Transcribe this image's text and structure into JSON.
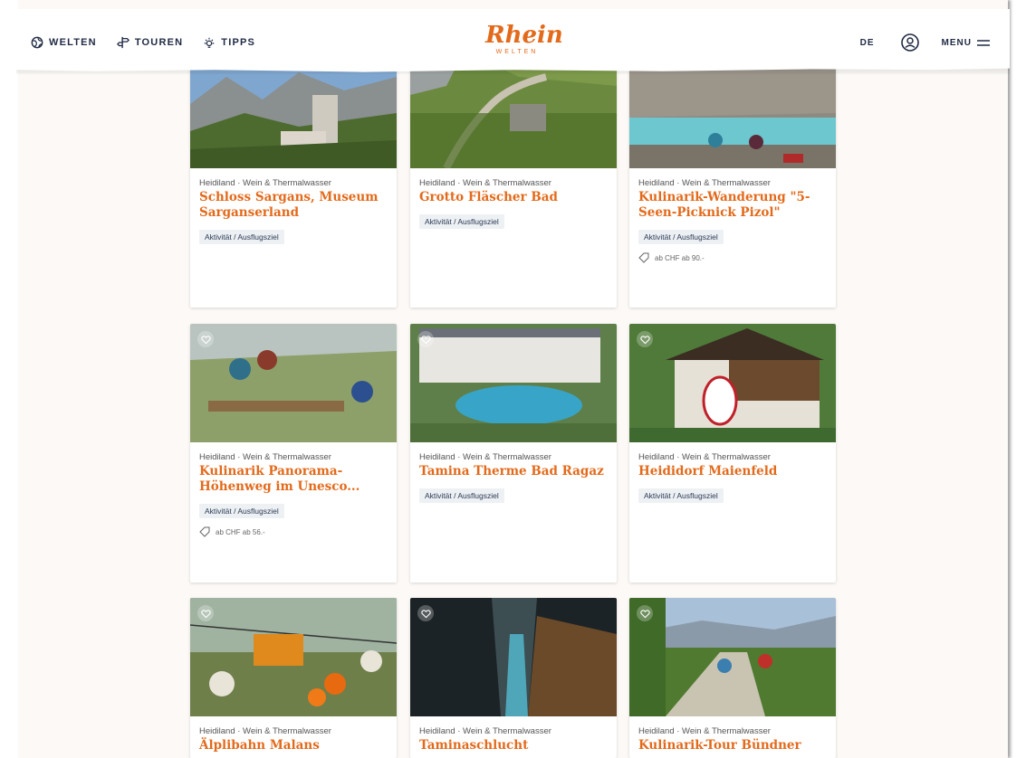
{
  "header": {
    "nav": [
      {
        "label": "WELTEN",
        "icon": "globe-icon"
      },
      {
        "label": "TOUREN",
        "icon": "signpost-icon"
      },
      {
        "label": "TIPPS",
        "icon": "sun-icon"
      }
    ],
    "logo": {
      "main": "Rhein",
      "sub": "WELTEN"
    },
    "lang": "DE",
    "menu_label": "MENU"
  },
  "colors": {
    "accent": "#e36a1b",
    "text": "#1f2a44",
    "tag_bg": "#eef1f4",
    "page_bg": "#fcf9f6"
  },
  "cards": [
    {
      "meta": "Heidiland · Wein & Thermalwasser",
      "title": "Schloss Sargans, Museum Sarganserland",
      "tag": "Aktivität / Ausflugsziel",
      "price": "",
      "image": "castle"
    },
    {
      "meta": "Heidiland · Wein & Thermalwasser",
      "title": "Grotto Fläscher Bad",
      "tag": "Aktivität / Ausflugsziel",
      "price": "",
      "image": "vineyard"
    },
    {
      "meta": "Heidiland · Wein & Thermalwasser",
      "title": "Kulinarik-Wanderung \"5-Seen-Picknick Pizol\"",
      "tag": "Aktivität / Ausflugsziel",
      "price": "ab CHF ab 90.-",
      "image": "lake"
    },
    {
      "meta": "Heidiland · Wein & Thermalwasser",
      "title": "Kulinarik Panorama-Höhenweg im Unesco...",
      "tag": "Aktivität / Ausflugsziel",
      "price": "ab CHF ab 56.-",
      "image": "picnic"
    },
    {
      "meta": "Heidiland · Wein & Thermalwasser",
      "title": "Tamina Therme Bad Ragaz",
      "tag": "Aktivität / Ausflugsziel",
      "price": "",
      "image": "therme"
    },
    {
      "meta": "Heidiland · Wein & Thermalwasser",
      "title": "Heididorf Maienfeld",
      "tag": "Aktivität / Ausflugsziel",
      "price": "",
      "image": "house"
    },
    {
      "meta": "Heidiland · Wein & Thermalwasser",
      "title": "Älplibahn Malans",
      "tag": "",
      "price": "",
      "image": "cablecar"
    },
    {
      "meta": "Heidiland · Wein & Thermalwasser",
      "title": "Taminaschlucht",
      "tag": "",
      "price": "",
      "image": "gorge"
    },
    {
      "meta": "Heidiland · Wein & Thermalwasser",
      "title": "Kulinarik-Tour Bündner",
      "tag": "",
      "price": "",
      "image": "bike"
    }
  ]
}
